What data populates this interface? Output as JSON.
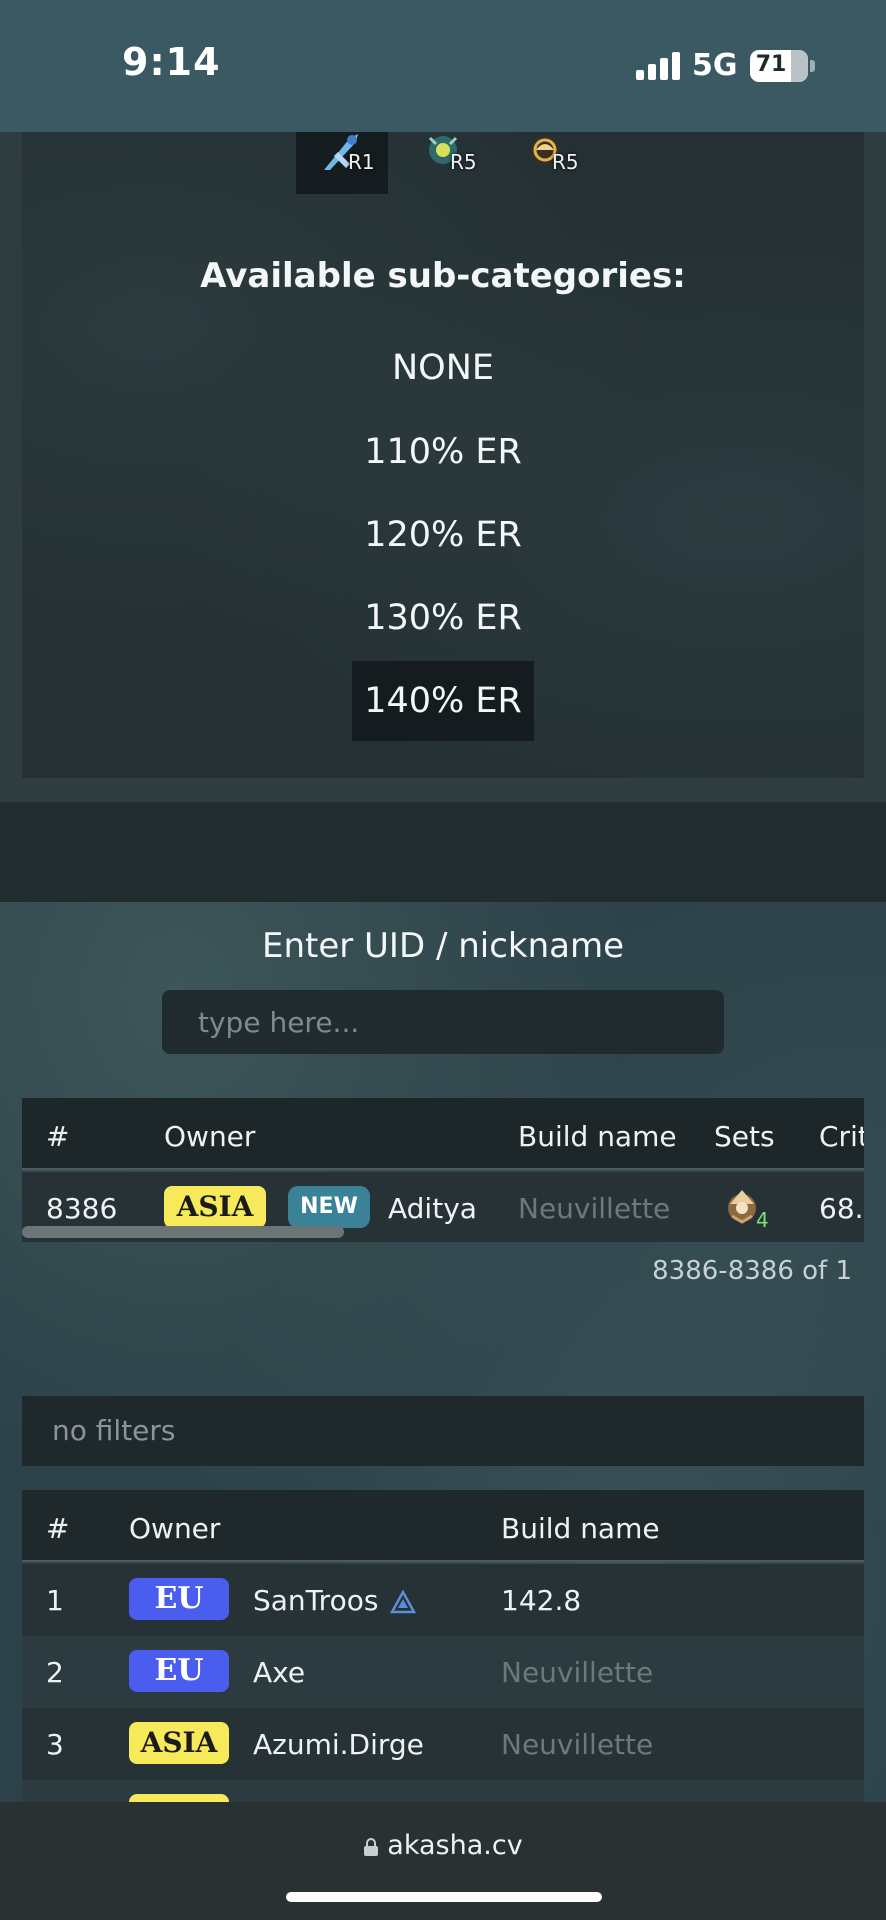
{
  "status_bar": {
    "time": "9:14",
    "network": "5G",
    "battery": "71",
    "battery_level": 0.71
  },
  "weapons": [
    {
      "icon": "blue-weapon-icon",
      "rank": "R1",
      "active": true
    },
    {
      "icon": "teal-weapon-icon",
      "rank": "R5",
      "active": false
    },
    {
      "icon": "gold-weapon-icon",
      "rank": "R5",
      "active": false
    }
  ],
  "subcategories": {
    "heading": "Available sub-categories:",
    "items": [
      "NONE",
      "110% ER",
      "120% ER",
      "130% ER",
      "140% ER"
    ],
    "selected": "140% ER"
  },
  "search": {
    "label": "Enter UID / nickname",
    "placeholder": "type here..."
  },
  "results": {
    "columns": [
      "#",
      "Owner",
      "Build name",
      "Sets",
      "Crit"
    ],
    "rows": [
      {
        "rank": "8386",
        "region": "ASIA",
        "tag": "NEW",
        "owner": "Aditya",
        "build": "Neuvillette",
        "sets_count": "4",
        "crit": "68."
      }
    ],
    "pagination": "8386-8386 of 1"
  },
  "filters": {
    "text": "no filters"
  },
  "leaderboard": {
    "columns": [
      "#",
      "Owner",
      "Build name"
    ],
    "rows": [
      {
        "rank": "1",
        "region": "EU",
        "owner": "SanTroos",
        "build": "142.8"
      },
      {
        "rank": "2",
        "region": "EU",
        "owner": "Axe",
        "build": "Neuvillette"
      },
      {
        "rank": "3",
        "region": "ASIA",
        "owner": "Azumi.Dirge",
        "build": "Neuvillette"
      }
    ]
  },
  "browser": {
    "url": "akasha.cv"
  },
  "colors": {
    "asia_badge": "#f6e95a",
    "eu_badge": "#4a5dee",
    "new_badge": "#3a8298",
    "status_bar": "#3a5963"
  }
}
